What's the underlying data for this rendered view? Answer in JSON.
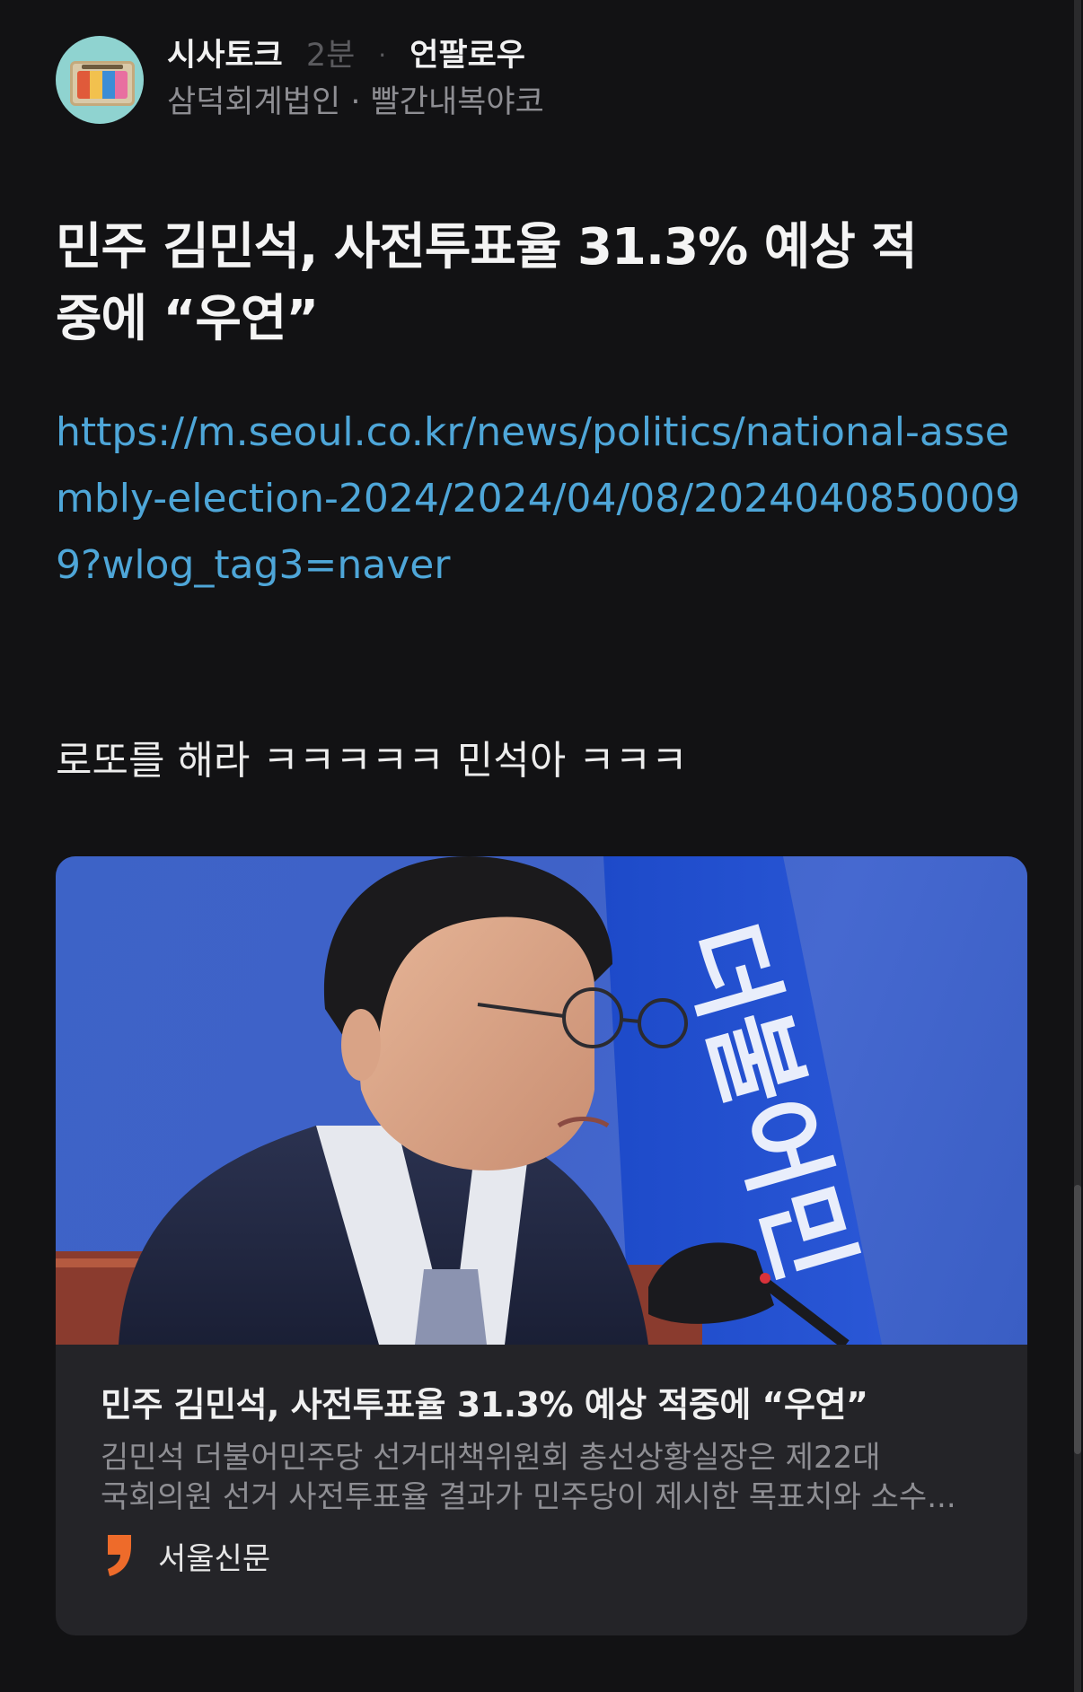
{
  "post": {
    "category": "시사토크",
    "time": "2분",
    "separator": "·",
    "follow_label": "언팔로우",
    "author": "삼덕회계법인 · 빨간내복야코",
    "title": "민주 김민석, 사전투표율 31.3% 예상 적중에 “우연”",
    "link": "https://m.seoul.co.kr/news/politics/national-assembly-election-2024/2024/04/08/20240408500099?wlog_tag3=naver",
    "body": "로또를 해라 ㅋㅋㅋㅋㅋ 민석아 ㅋㅋㅋ"
  },
  "card": {
    "title": "민주 김민석, 사전투표율 31.3% 예상 적중에 “우연”",
    "desc_line1": "김민석 더불어민주당 선거대책위원회 총선상황실장은 제22대",
    "desc_line2": "국회의원 선거 사전투표율 결과가 민주당이 제시한 목표치와 소수...",
    "source": "서울신문",
    "image_banner_text": "더불어민"
  },
  "icons": {
    "avatar": "board-avatar-icon",
    "source_logo": "seoul-shinmun-logo-icon"
  },
  "colors": {
    "background": "#121214",
    "link": "#4ea6d8",
    "card_background": "#242428",
    "source_logo": "#ee6b2a"
  }
}
